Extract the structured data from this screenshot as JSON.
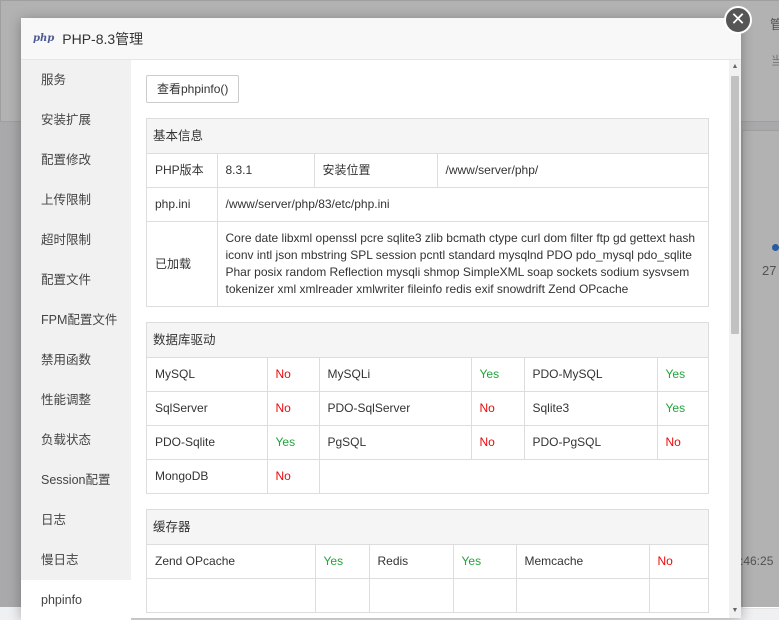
{
  "window": {
    "logo_text": "php",
    "title": "PHP-8.3管理",
    "close_glyph": "✕"
  },
  "background": {
    "right_top_text": "管",
    "right_top_sub": "当",
    "right_value": "27",
    "right_time": ":46:25"
  },
  "sidebar": {
    "items": [
      {
        "label": "服务"
      },
      {
        "label": "安装扩展"
      },
      {
        "label": "配置修改"
      },
      {
        "label": "上传限制"
      },
      {
        "label": "超时限制"
      },
      {
        "label": "配置文件"
      },
      {
        "label": "FPM配置文件"
      },
      {
        "label": "禁用函数"
      },
      {
        "label": "性能调整"
      },
      {
        "label": "负载状态"
      },
      {
        "label": "Session配置"
      },
      {
        "label": "日志"
      },
      {
        "label": "慢日志"
      },
      {
        "label": "phpinfo"
      }
    ],
    "active_index": 13
  },
  "toolbar": {
    "phpinfo_button": "查看phpinfo()"
  },
  "basic": {
    "title": "基本信息",
    "version_label": "PHP版本",
    "version_value": "8.3.1",
    "location_label": "安装位置",
    "location_value": "/www/server/php/",
    "ini_label": "php.ini",
    "ini_value": "/www/server/php/83/etc/php.ini",
    "loaded_label": "已加载",
    "loaded_value": "Core date libxml openssl pcre sqlite3 zlib bcmath ctype curl dom filter ftp gd gettext hash iconv intl json mbstring SPL session pcntl standard mysqlnd PDO pdo_mysql pdo_sqlite Phar posix random Reflection mysqli shmop SimpleXML soap sockets sodium sysvsem tokenizer xml xmlreader xmlwriter fileinfo redis exif snowdrift Zend OPcache"
  },
  "database": {
    "title": "数据库驱动",
    "rows": [
      [
        {
          "name": "MySQL",
          "status": "No"
        },
        {
          "name": "MySQLi",
          "status": "Yes"
        },
        {
          "name": "PDO-MySQL",
          "status": "Yes"
        }
      ],
      [
        {
          "name": "SqlServer",
          "status": "No"
        },
        {
          "name": "PDO-SqlServer",
          "status": "No"
        },
        {
          "name": "Sqlite3",
          "status": "Yes"
        }
      ],
      [
        {
          "name": "PDO-Sqlite",
          "status": "Yes"
        },
        {
          "name": "PgSQL",
          "status": "No"
        },
        {
          "name": "PDO-PgSQL",
          "status": "No"
        }
      ]
    ],
    "mongodb": {
      "name": "MongoDB",
      "status": "No"
    }
  },
  "cache": {
    "title": "缓存器",
    "rows": [
      [
        {
          "name": "Zend OPcache",
          "status": "Yes"
        },
        {
          "name": "Redis",
          "status": "Yes"
        },
        {
          "name": "Memcache",
          "status": "No"
        }
      ]
    ]
  },
  "colors": {
    "yes": "#20a53a",
    "no": "#ef0808"
  }
}
